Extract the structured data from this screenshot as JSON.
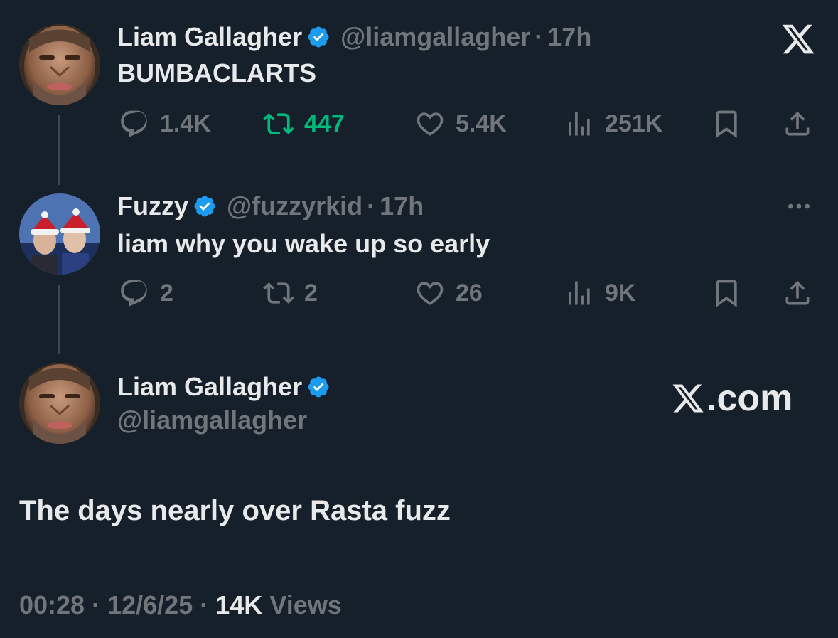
{
  "colors": {
    "background": "#16202a",
    "text_primary": "#e7e9ea",
    "text_secondary": "#71767b",
    "verified_blue": "#1d9bf0",
    "retweet_green": "#00ba7c"
  },
  "tweet1": {
    "name": "Liam Gallagher",
    "handle": "@liamgallagher",
    "time_sep": "·",
    "time": "17h",
    "text": "BUMBACLARTS",
    "actions": {
      "replies": "1.4K",
      "retweets": "447",
      "likes": "5.4K",
      "views": "251K"
    },
    "retweeted": true
  },
  "tweet2": {
    "name": "Fuzzy",
    "handle": "@fuzzyrkid",
    "time_sep": "·",
    "time": "17h",
    "text": "liam why you wake up so early",
    "actions": {
      "replies": "2",
      "retweets": "2",
      "likes": "26",
      "views": "9K"
    }
  },
  "main_tweet": {
    "name": "Liam Gallagher",
    "handle": "@liamgallagher",
    "text": "The days nearly over Rasta fuzz",
    "time": "00:28",
    "date": "12/6/25",
    "views_count": "14K",
    "views_label": "Views",
    "sep": "·"
  },
  "brand": {
    "logo_text": "X",
    "site_label": ".com"
  },
  "icons": [
    "x-logo-icon",
    "verified-icon",
    "reply-icon",
    "retweet-icon",
    "like-icon",
    "views-icon",
    "bookmark-icon",
    "share-icon",
    "more-icon"
  ]
}
